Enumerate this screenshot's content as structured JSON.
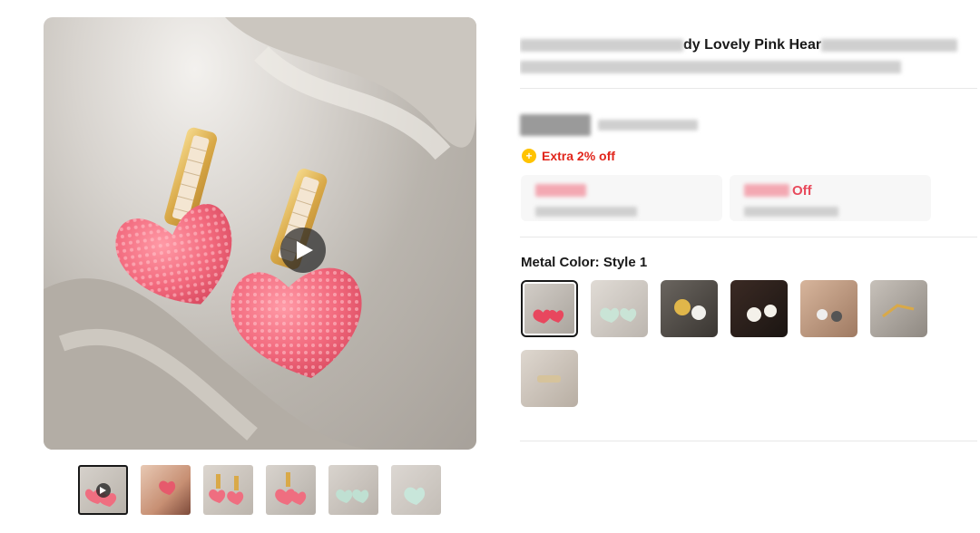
{
  "product": {
    "title_visible": "dy Lovely Pink Hear",
    "extra_discount": "Extra 2% off",
    "coupon_right_suffix": "Off",
    "metal_color_label": "Metal Color: Style 1"
  },
  "icons": {
    "play": "play-icon",
    "coin": "coin-icon"
  },
  "colors": {
    "accent_red": "#e1251b",
    "coupon_pink": "#e8495b",
    "coin_yellow": "#ffc300"
  }
}
